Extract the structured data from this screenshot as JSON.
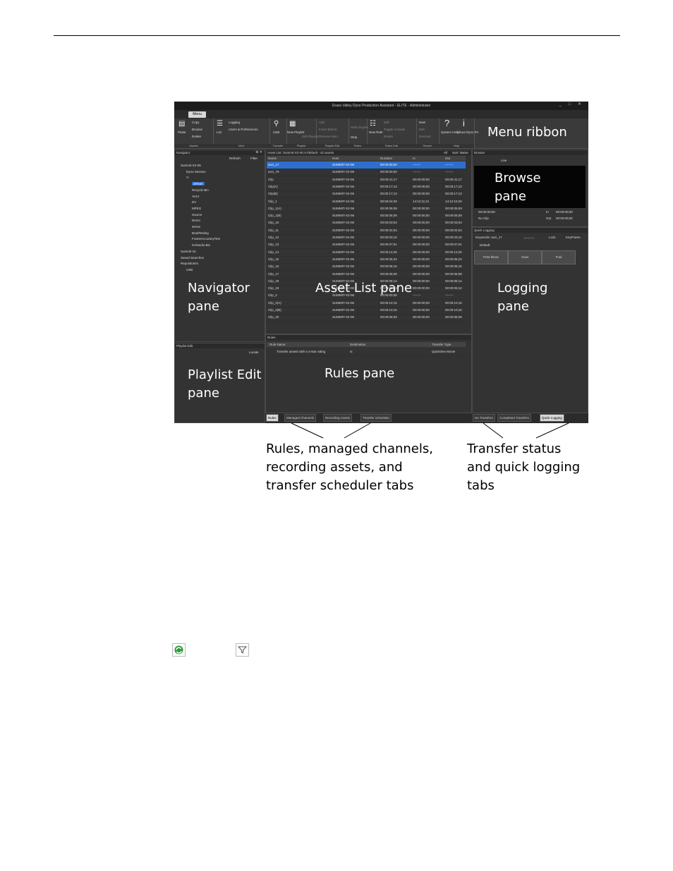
{
  "app": {
    "title": "Grass Valley Dyno Production Assistant - ELITE - Administrator",
    "window_controls": "_ □ ✕",
    "menu_label": "Menu"
  },
  "ribbon": {
    "groups": [
      {
        "name": "Assets",
        "items": [
          "Paste",
          "Copy",
          "Browse",
          "Delete"
        ]
      },
      {
        "name": "View",
        "items": [
          "List",
          "Logging",
          "Users & Preferences"
        ]
      },
      {
        "name": "Transfer",
        "items": [
          "USB"
        ]
      },
      {
        "name": "Playlist",
        "items": [
          "New Playlist",
          "Edit Playlist"
        ]
      },
      {
        "name": "Playlist Edit",
        "items": [
          "Add",
          "Insert Before",
          "Remove Item"
        ]
      },
      {
        "name": "Rules",
        "items": [
          "Start Engine",
          "Stop"
        ]
      },
      {
        "name": "Rules Edit",
        "items": [
          "New Rule",
          "Edit",
          "Toggle Activate",
          "Delete"
        ]
      },
      {
        "name": "Search",
        "items": [
          "New",
          "Edit",
          "Remove"
        ]
      },
      {
        "name": "Help",
        "items": [
          "System Help",
          "About Dyno PA"
        ]
      }
    ]
  },
  "navigator": {
    "title": "Navigator",
    "refresh": "Refresh",
    "filter": "Filter",
    "tree": [
      {
        "label": "Summit-X2-06",
        "indent": 0
      },
      {
        "label": "Dyno Session",
        "indent": 1
      },
      {
        "label": "V:",
        "indent": 1
      },
      {
        "label": "default",
        "indent": 2,
        "selected": true
      },
      {
        "label": "Recycle Bin",
        "indent": 2
      },
      {
        "label": "AVCI",
        "indent": 2
      },
      {
        "label": "DV",
        "indent": 2
      },
      {
        "label": "MPEG",
        "indent": 2
      },
      {
        "label": "Source",
        "indent": 2
      },
      {
        "label": "Demo",
        "indent": 2
      },
      {
        "label": "stress",
        "indent": 2
      },
      {
        "label": "BradTesting",
        "indent": 2
      },
      {
        "label": "FrameAccuracyTest",
        "indent": 2
      },
      {
        "label": "K2Studio Bin",
        "indent": 2
      },
      {
        "label": "Summit 16",
        "indent": 0
      },
      {
        "label": "Saved Searches",
        "indent": 0
      },
      {
        "label": "Repositories",
        "indent": 0
      },
      {
        "label": "USB",
        "indent": 1
      }
    ]
  },
  "playlist_edit": {
    "title": "Playlist Edit",
    "locate": "Locate"
  },
  "asset_list": {
    "title": "Asset List: Summit-X2-06:V:/default - 42 assets",
    "filter_label": "All",
    "sort_label": "Sort: Name",
    "columns": [
      "Name",
      "Host",
      "Duration",
      "In",
      "Out"
    ],
    "rows": [
      [
        "avci_17",
        "SUMMIT-X2-06",
        "00:00:00;00",
        "--:--:--",
        "--:--:--"
      ],
      [
        "avci_75",
        "SUMMIT-X2-06",
        "00:00:00;00",
        "--:--:--",
        "--:--:--"
      ],
      [
        "Clip",
        "SUMMIT-X2-06",
        "00:00:41;17",
        "00:00:00;00",
        "00:00:41;17"
      ],
      [
        "Clip(A)",
        "SUMMIT-X2-06",
        "00:00:17;13",
        "00:00:00;00",
        "00:00:17;13"
      ],
      [
        "Clip(B)",
        "SUMMIT-X2-06",
        "00:00:17;13",
        "00:00:00;00",
        "00:00:17;13"
      ],
      [
        "Clip_1",
        "SUMMIT-X2-06",
        "00:00:04;29",
        "14:12:11;21",
        "14:12:16;20"
      ],
      [
        "Clip_1(A)",
        "SUMMIT-X2-06",
        "00:00:05;09",
        "00:00:00;00",
        "00:00:05;09"
      ],
      [
        "Clip_1(B)",
        "SUMMIT-X2-06",
        "00:00:05;09",
        "00:00:00;00",
        "00:00:05;09"
      ],
      [
        "Clip_10",
        "SUMMIT-X2-06",
        "00:00:03;04",
        "00:00:00;00",
        "00:00:03;04"
      ],
      [
        "Clip_11",
        "SUMMIT-X2-06",
        "00:00:04;04",
        "00:00:00;00",
        "00:00:04;04"
      ],
      [
        "Clip_12",
        "SUMMIT-X2-06",
        "00:00:03;10",
        "00:00:00;00",
        "00:00:03;10"
      ],
      [
        "Clip_13",
        "SUMMIT-X2-06",
        "00:00:07;01",
        "00:00:00;00",
        "00:00:07;01"
      ],
      [
        "Clip_14",
        "SUMMIT-X2-06",
        "00:00:12;25",
        "00:00:00;00",
        "00:00:12;25"
      ],
      [
        "Clip_15",
        "SUMMIT-X2-06",
        "00:00:05;22",
        "00:00:00;00",
        "00:00:05;22"
      ],
      [
        "Clip_16",
        "SUMMIT-X2-06",
        "00:00:06;15",
        "00:00:00;00",
        "00:00:06;15"
      ],
      [
        "Clip_17",
        "SUMMIT-X2-06",
        "00:00:06;08",
        "00:00:00;00",
        "00:00:06;08"
      ],
      [
        "Clip_18",
        "SUMMIT-X2-06",
        "00:00:06;14",
        "00:00:00;00",
        "00:00:06;14"
      ],
      [
        "Clip_19",
        "SUMMIT-X2-06",
        "00:00:05;12",
        "00:00:00;00",
        "00:00:05;12"
      ],
      [
        "Clip_2",
        "SUMMIT-X2-06",
        "00:00:00;00",
        "--:--:--",
        "--:--:--"
      ],
      [
        "Clip_2(A)",
        "SUMMIT-X2-06",
        "00:00:10;16",
        "00:00:00;00",
        "00:00:10;16"
      ],
      [
        "Clip_2(B)",
        "SUMMIT-X2-06",
        "00:00:10;16",
        "00:00:00;00",
        "00:00:10;16"
      ],
      [
        "Clip_20",
        "SUMMIT-X2-06",
        "00:00:06;09",
        "00:00:00;00",
        "00:00:06;09"
      ]
    ]
  },
  "rules": {
    "title": "Rules",
    "columns": [
      "Rule Name",
      "Destination",
      "Transfer Type"
    ],
    "rows": [
      [
        "Transfer assets with a 3-star rating",
        "S:",
        "Quicktime Movie"
      ]
    ]
  },
  "browse": {
    "title": "Browse",
    "live": "Live",
    "timecode": "00:00:00;00",
    "in_label": "In",
    "in_value": "00:00:00;00",
    "out_label": "Out",
    "out_value": "00:00:00;00",
    "clip": "No Clip"
  },
  "quick_logging": {
    "title": "Quick Logging",
    "keywords": "Keywords: avci_17",
    "timecode": "--:--:--:--",
    "lock": "Lock",
    "keyframe": "KeyFrame",
    "tab": "Default",
    "buttons": [
      "Free throw",
      "Goal",
      "Foul"
    ]
  },
  "bottom_tabs_left": [
    "Rules",
    "Managed Channels",
    "Recording Assets",
    "Transfer Scheduler"
  ],
  "bottom_tabs_right": [
    "ive Transfers",
    "Completed Transfers",
    "Quick Logging"
  ],
  "overlays": {
    "menu_ribbon": "Menu ribbon",
    "browse_1": "Browse",
    "browse_2": "pane",
    "navigator_1": "Navigator",
    "navigator_2": "pane",
    "asset_list": "Asset List pane",
    "logging_1": "Logging",
    "logging_2": "pane",
    "playlist_1": "Playlist Edit",
    "playlist_2": "pane",
    "rules": "Rules pane"
  },
  "callouts": {
    "left": [
      "Rules, managed channels,",
      "recording assets, and",
      "transfer scheduler tabs"
    ],
    "right": [
      "Transfer status",
      "and quick logging",
      "tabs"
    ]
  }
}
